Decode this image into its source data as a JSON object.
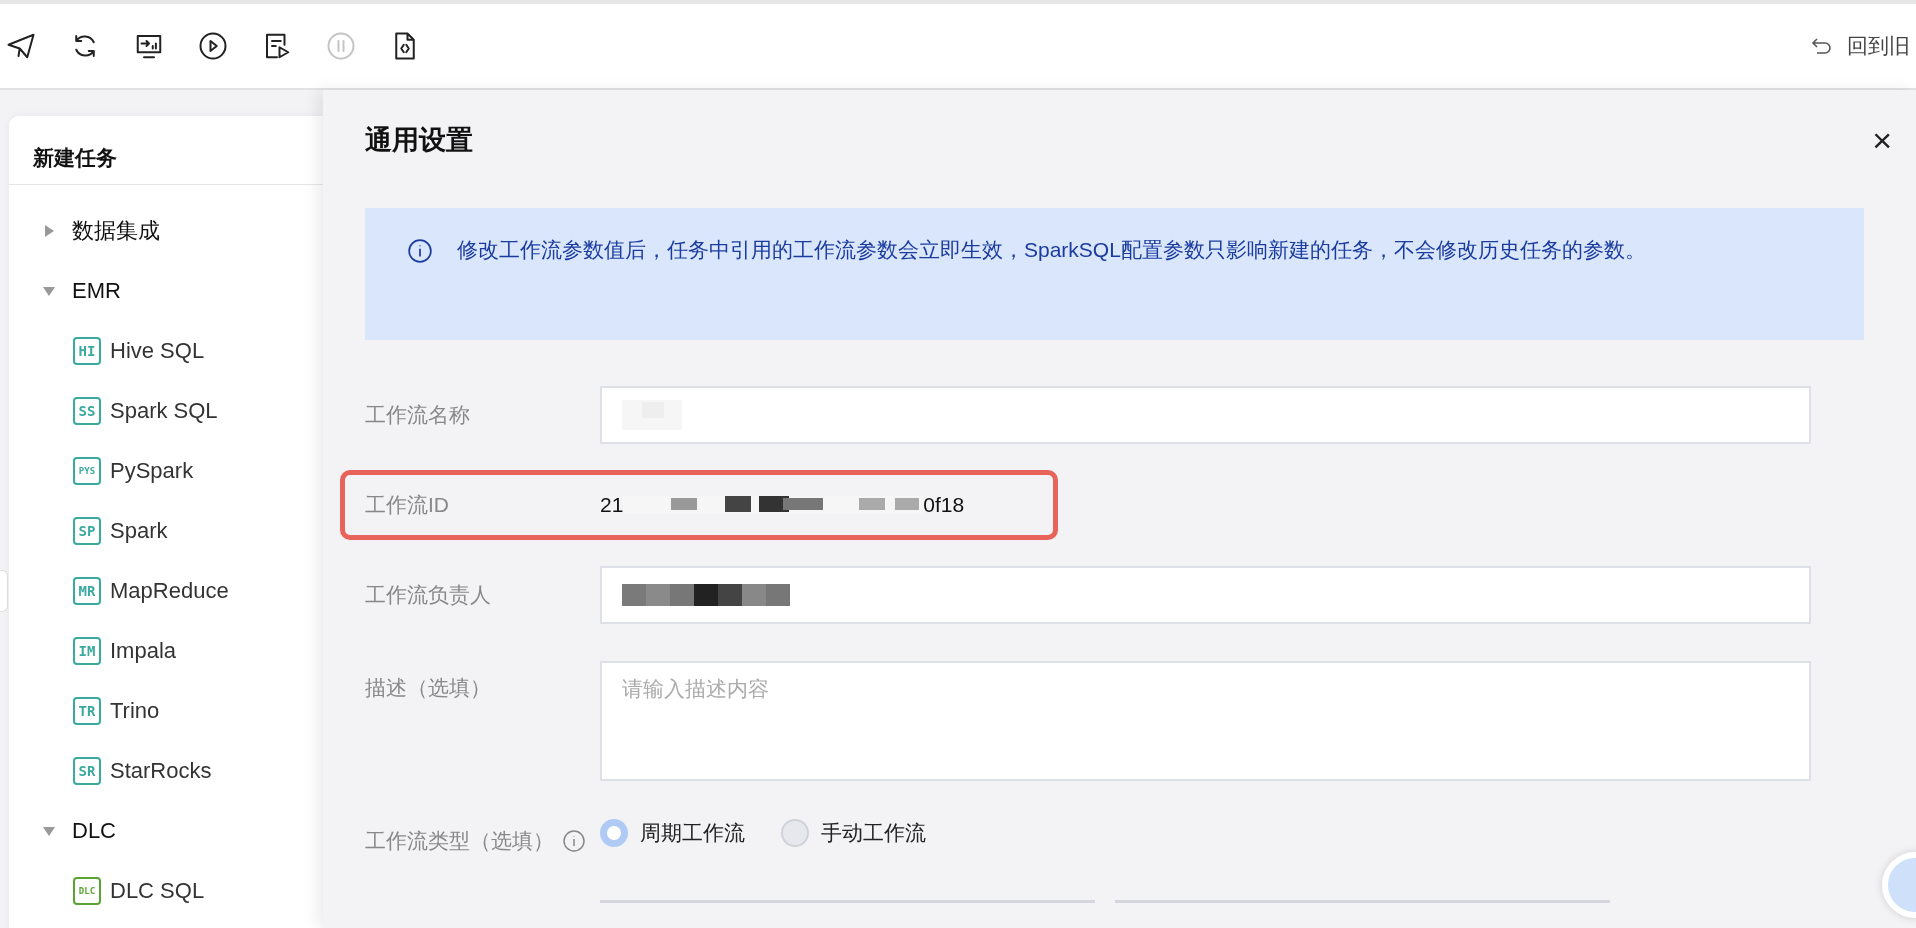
{
  "toolbar": {
    "buttons": [
      {
        "kind": "send",
        "disabled": false
      },
      {
        "kind": "refresh",
        "disabled": false
      },
      {
        "kind": "monitor",
        "disabled": false
      },
      {
        "kind": "run",
        "disabled": false
      },
      {
        "kind": "run-script",
        "disabled": false
      },
      {
        "kind": "pause",
        "disabled": true
      },
      {
        "kind": "code-file",
        "disabled": false
      }
    ],
    "back_link": "回到旧"
  },
  "sidebar": {
    "title": "新建任务",
    "groups": [
      {
        "label": "数据集成",
        "expanded": false
      },
      {
        "label": "EMR",
        "expanded": true,
        "children": [
          {
            "badge": "HI",
            "label": "Hive SQL",
            "color": "#3aa99f"
          },
          {
            "badge": "SS",
            "label": "Spark SQL",
            "color": "#3aa99f"
          },
          {
            "badge": "PYS",
            "label": "PySpark",
            "color": "#3aa99f"
          },
          {
            "badge": "SP",
            "label": "Spark",
            "color": "#3aa99f"
          },
          {
            "badge": "MR",
            "label": "MapReduce",
            "color": "#3aa99f"
          },
          {
            "badge": "IM",
            "label": "Impala",
            "color": "#3aa99f"
          },
          {
            "badge": "TR",
            "label": "Trino",
            "color": "#3aa99f"
          },
          {
            "badge": "SR",
            "label": "StarRocks",
            "color": "#3aa99f"
          }
        ]
      },
      {
        "label": "DLC",
        "expanded": true,
        "children": [
          {
            "badge": "DLC",
            "label": "DLC SQL",
            "color": "#5aa532"
          }
        ]
      }
    ]
  },
  "drawer": {
    "title": "通用设置",
    "close": "×",
    "notice": "修改工作流参数值后，任务中引用的工作流参数会立即生效，SparkSQL配置参数只影响新建的任务，不会修改历史任务的参数。",
    "fields": [
      {
        "kind": "name",
        "label": "工作流名称",
        "highlighted": false
      },
      {
        "kind": "text",
        "label": "工作流ID",
        "value_start": "21",
        "value_end": "0f18",
        "highlighted": true
      },
      {
        "kind": "owner",
        "label": "工作流负责人",
        "highlighted": false
      },
      {
        "kind": "textarea",
        "label": "描述（选填）",
        "placeholder": "请输入描述内容",
        "highlighted": false
      },
      {
        "kind": "radio",
        "label": "工作流类型（选填）",
        "options": [
          {
            "label": "周期工作流",
            "selected": true
          },
          {
            "label": "手动工作流",
            "selected": false
          }
        ],
        "highlighted": false
      }
    ]
  }
}
